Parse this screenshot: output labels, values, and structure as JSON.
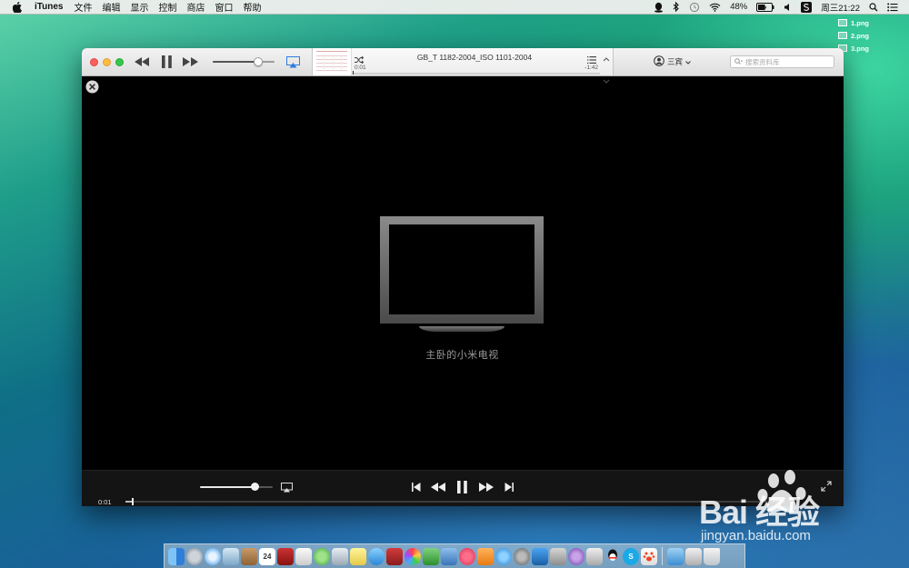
{
  "menubar": {
    "app_name": "iTunes",
    "menus": [
      "文件",
      "编辑",
      "显示",
      "控制",
      "商店",
      "窗口",
      "帮助"
    ],
    "battery_percent": "48%",
    "clock": "周三21:22"
  },
  "desktop": {
    "files": [
      "1.png",
      "2.png",
      "3.png"
    ]
  },
  "itunes": {
    "lcd": {
      "title": "GB_T 1182-2004_ISO 1101-2004",
      "elapsed": "0:01",
      "remaining": "-1:42"
    },
    "account_name": "三宾",
    "search_placeholder": "搜索资料库",
    "airplay_device": "主卧的小米电视",
    "controls": {
      "elapsed": "0:01",
      "volume_level": 0.75,
      "playback_progress": 0.01
    }
  },
  "dock": {
    "apps": [
      "Finder",
      "Launchpad",
      "Safari",
      "Preview",
      "Contacts",
      "Calendar",
      "Dictionary",
      "TextEdit",
      "Messages",
      "Preview2",
      "Notes",
      "FaceTime",
      "Photo Booth",
      "iPhoto",
      "Numbers",
      "Keynote",
      "iTunes",
      "iBooks",
      "App Store",
      "System Preferences",
      "Xcode",
      "Boot Camp",
      "VirtualBox",
      "QQ",
      "Skype",
      "Baidu"
    ],
    "tail": [
      "Downloads",
      "Documents",
      "Trash"
    ]
  },
  "watermark": {
    "logo": "Bai 经验",
    "text": "jingyan.baidu.com"
  }
}
